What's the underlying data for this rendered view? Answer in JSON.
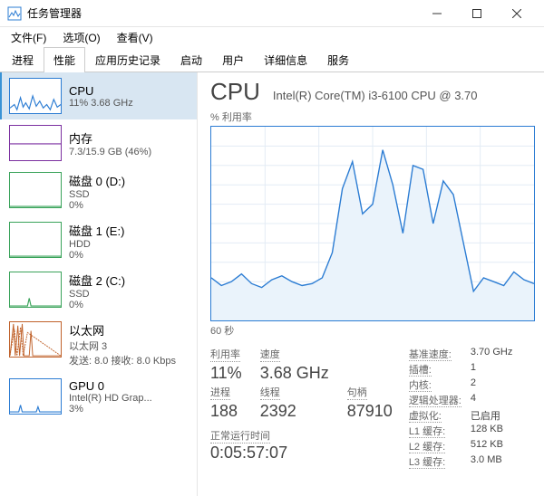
{
  "window": {
    "title": "任务管理器"
  },
  "menu": {
    "file": "文件(F)",
    "options": "选项(O)",
    "view": "查看(V)"
  },
  "tabs": [
    "进程",
    "性能",
    "应用历史记录",
    "启动",
    "用户",
    "详细信息",
    "服务"
  ],
  "sidebar": [
    {
      "title": "CPU",
      "sub1": "11% 3.68 GHz",
      "color": "#2b7cd3"
    },
    {
      "title": "内存",
      "sub1": "7.3/15.9 GB (46%)",
      "color": "#7b2fa0"
    },
    {
      "title": "磁盘 0 (D:)",
      "sub1": "SSD",
      "sub2": "0%",
      "color": "#3aa35a"
    },
    {
      "title": "磁盘 1 (E:)",
      "sub1": "HDD",
      "sub2": "0%",
      "color": "#3aa35a"
    },
    {
      "title": "磁盘 2 (C:)",
      "sub1": "SSD",
      "sub2": "0%",
      "color": "#3aa35a"
    },
    {
      "title": "以太网",
      "sub1": "以太网 3",
      "sub2": "发送: 8.0  接收: 8.0 Kbps",
      "color": "#c0622b"
    },
    {
      "title": "GPU 0",
      "sub1": "Intel(R) HD Grap...",
      "sub2": "3%",
      "color": "#2b7cd3"
    }
  ],
  "detail": {
    "title": "CPU",
    "model": "Intel(R) Core(TM) i3-6100 CPU @ 3.70",
    "chart_label": "% 利用率",
    "chart_footer": "60 秒",
    "stats": {
      "util_label": "利用率",
      "util": "11%",
      "speed_label": "速度",
      "speed": "3.68 GHz",
      "proc_label": "进程",
      "proc": "188",
      "threads_label": "线程",
      "threads": "2392",
      "handles_label": "句柄",
      "handles": "87910",
      "uptime_label": "正常运行时间",
      "uptime": "0:05:57:07"
    },
    "right": {
      "base_label": "基准速度:",
      "base": "3.70 GHz",
      "sockets_label": "插槽:",
      "sockets": "1",
      "cores_label": "内核:",
      "cores": "2",
      "lp_label": "逻辑处理器:",
      "lp": "4",
      "virt_label": "虚拟化:",
      "virt": "已启用",
      "l1_label": "L1 缓存:",
      "l1": "128 KB",
      "l2_label": "L2 缓存:",
      "l2": "512 KB",
      "l3_label": "L3 缓存:",
      "l3": "3.0 MB"
    }
  },
  "chart_data": {
    "type": "line",
    "title": "% 利用率",
    "xlabel": "60 秒",
    "ylabel": "",
    "ylim": [
      0,
      100
    ],
    "x_range_seconds": 60,
    "values": [
      22,
      18,
      20,
      24,
      19,
      17,
      21,
      23,
      20,
      18,
      19,
      22,
      35,
      68,
      82,
      55,
      60,
      88,
      70,
      45,
      80,
      78,
      50,
      72,
      65,
      40,
      15,
      22,
      20,
      18,
      25,
      21,
      19
    ]
  }
}
